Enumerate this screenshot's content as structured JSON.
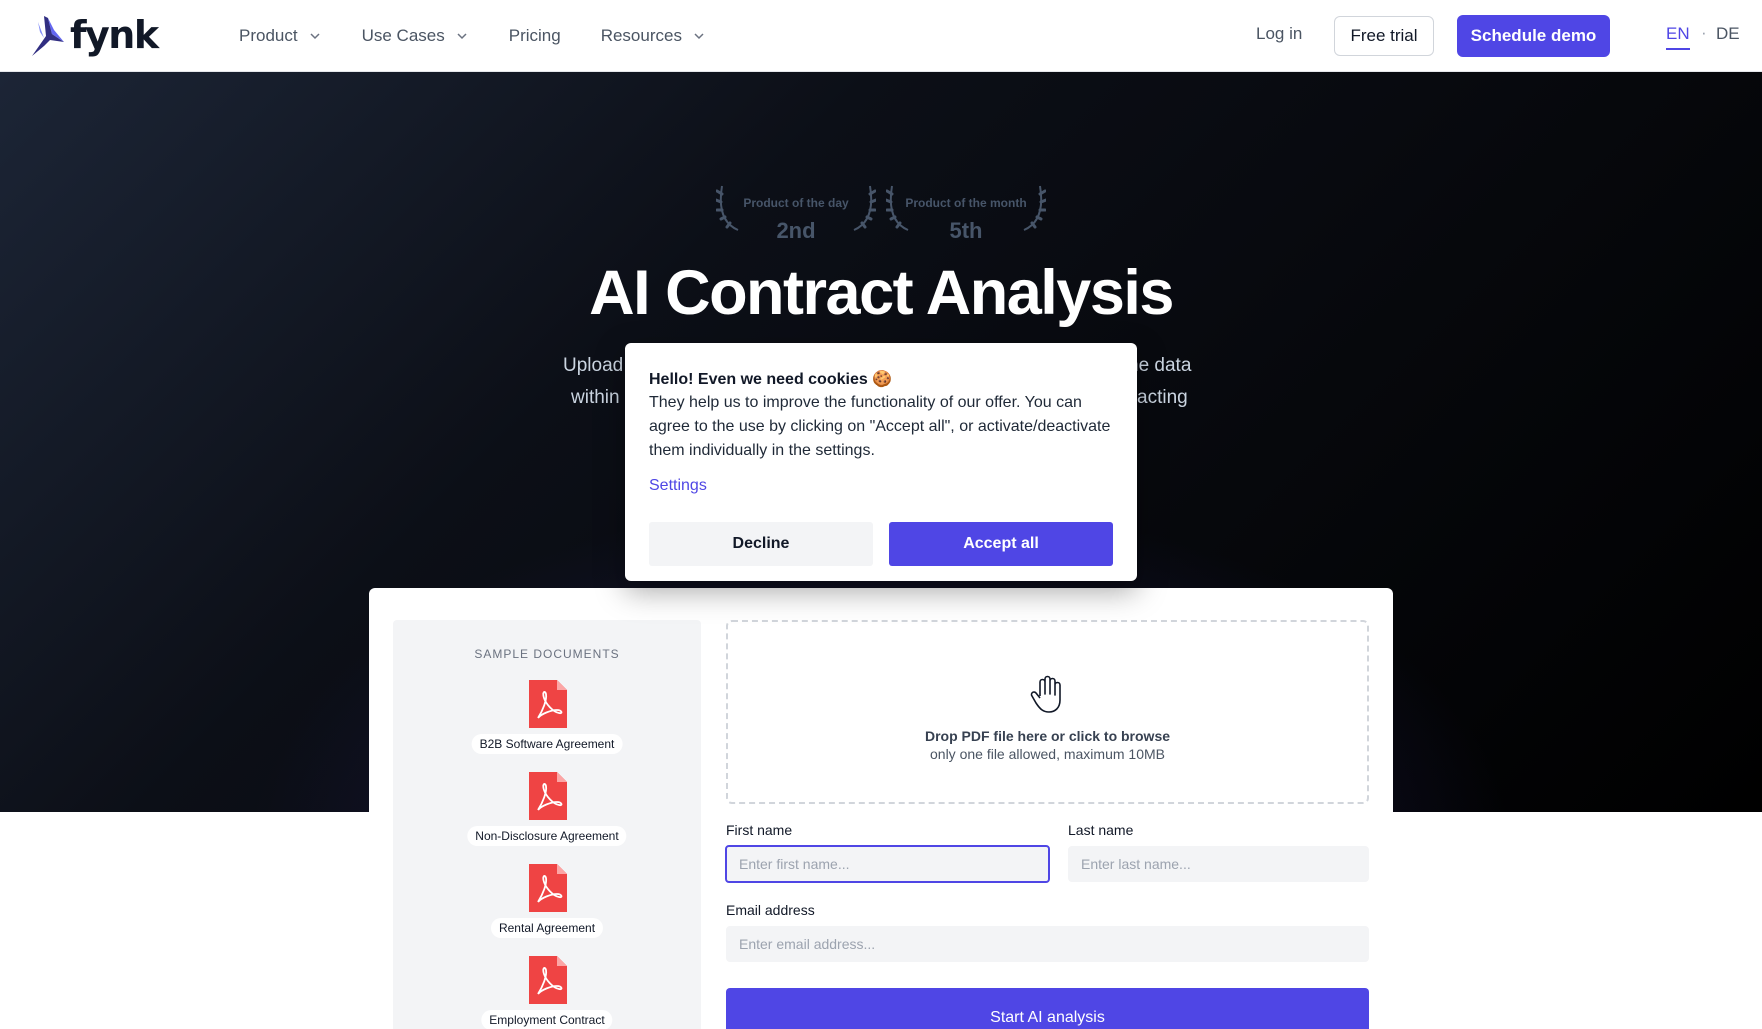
{
  "header": {
    "logo_text": "fynk",
    "nav": [
      {
        "label": "Product",
        "has_dropdown": true
      },
      {
        "label": "Use Cases",
        "has_dropdown": true
      },
      {
        "label": "Pricing",
        "has_dropdown": false
      },
      {
        "label": "Resources",
        "has_dropdown": true
      }
    ],
    "login_label": "Log in",
    "free_trial_label": "Free trial",
    "schedule_demo_label": "Schedule demo",
    "lang_en": "EN",
    "lang_separator": "·",
    "lang_de": "DE"
  },
  "hero": {
    "awards": [
      {
        "label": "Product of the day",
        "rank": "2nd"
      },
      {
        "label": "Product of the month",
        "rank": "5th"
      }
    ],
    "title": "AI Contract Analysis",
    "subtitle_line1": "Upload",
    "subtitle_line1_end": "he data",
    "subtitle_line2": "within",
    "subtitle_line2_end": "acting"
  },
  "cookie": {
    "title": "Hello! Even we need cookies 🍪",
    "text": "They help us to improve the functionality of our offer. You can agree to the use by clicking on \"Accept all\", or activate/deactivate them individually in the settings.",
    "settings_label": "Settings",
    "decline_label": "Decline",
    "accept_label": "Accept all"
  },
  "samples": {
    "title": "SAMPLE DOCUMENTS",
    "items": [
      {
        "label": "B2B Software Agreement"
      },
      {
        "label": "Non-Disclosure Agreement"
      },
      {
        "label": "Rental Agreement"
      },
      {
        "label": "Employment Contract"
      }
    ]
  },
  "dropzone": {
    "main": "Drop PDF file here or click to browse",
    "sub": "only one file allowed, maximum 10MB"
  },
  "form": {
    "first_name_label": "First name",
    "first_name_placeholder": "Enter first name...",
    "last_name_label": "Last name",
    "last_name_placeholder": "Enter last name...",
    "email_label": "Email address",
    "email_placeholder": "Enter email address...",
    "submit_label": "Start AI analysis"
  },
  "colors": {
    "accent": "#4f46e5",
    "pdf_red": "#ef4444",
    "hero_bg": "#000000"
  },
  "icons": [
    "fynk-logo-bird-icon",
    "chevron-down-icon",
    "laurel-icon",
    "pdf-file-icon",
    "hand-cursor-icon"
  ]
}
